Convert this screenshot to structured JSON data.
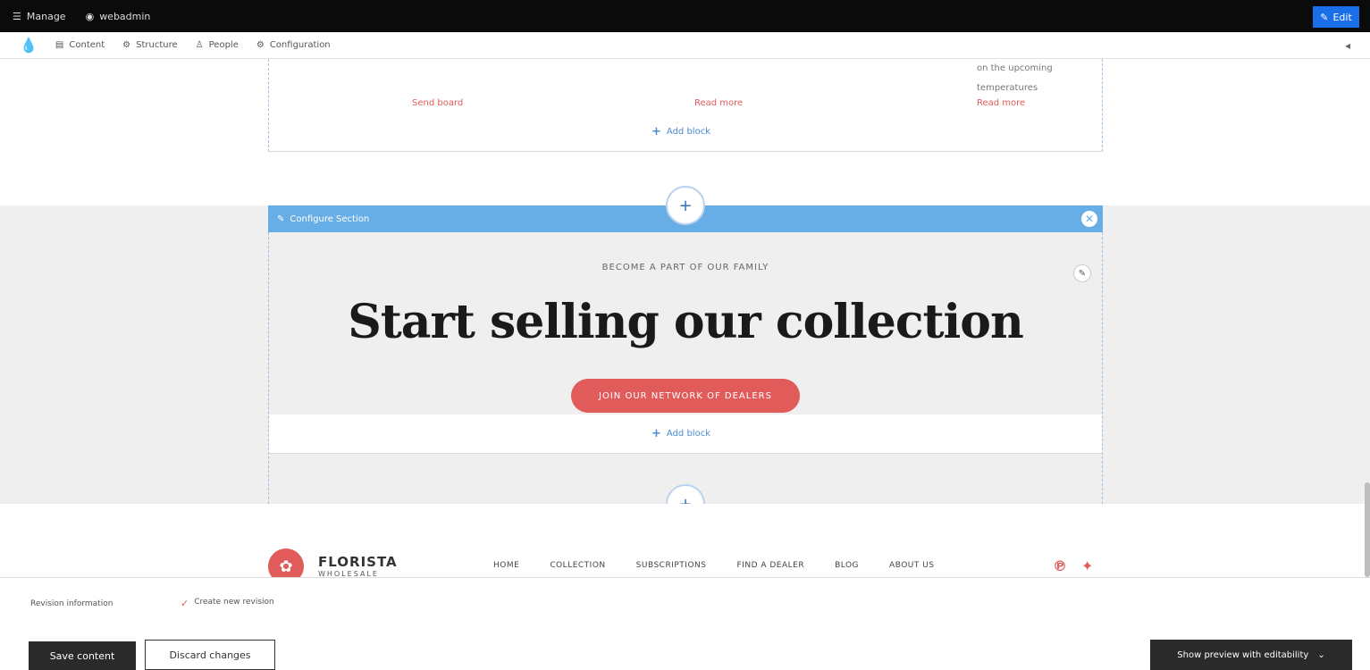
{
  "topbar": {
    "manage_label": "Manage",
    "user_label": "webadmin",
    "edit_label": "Edit"
  },
  "toolbar": {
    "content": "Content",
    "structure": "Structure",
    "people": "People",
    "configuration": "Configuration"
  },
  "section_top": {
    "text_line1": "on the upcoming",
    "text_line2": "temperatures",
    "links": [
      "Send board",
      "Read more",
      "Read more"
    ],
    "add_block": "Add block"
  },
  "config_bar": {
    "label": "Configure Section"
  },
  "cta": {
    "eyebrow": "BECOME A PART OF OUR FAMILY",
    "headline": "Start selling our collection",
    "button": "JOIN OUR NETWORK OF DEALERS",
    "add_block": "Add block"
  },
  "footer": {
    "brand": "FLORISTA",
    "brand_sub": "WHOLESALE",
    "nav": [
      "HOME",
      "COLLECTION",
      "SUBSCRIPTIONS",
      "FIND A DEALER",
      "BLOG",
      "ABOUT US"
    ]
  },
  "revision": {
    "label": "Revision information",
    "checkbox_label": "Create new revision"
  },
  "actions": {
    "save": "Save content",
    "discard": "Discard changes",
    "preview": "Show preview with editability"
  },
  "colors": {
    "accent": "#e25b5b",
    "config_bar": "#67aee6",
    "edit_button": "#1a6ee8"
  }
}
